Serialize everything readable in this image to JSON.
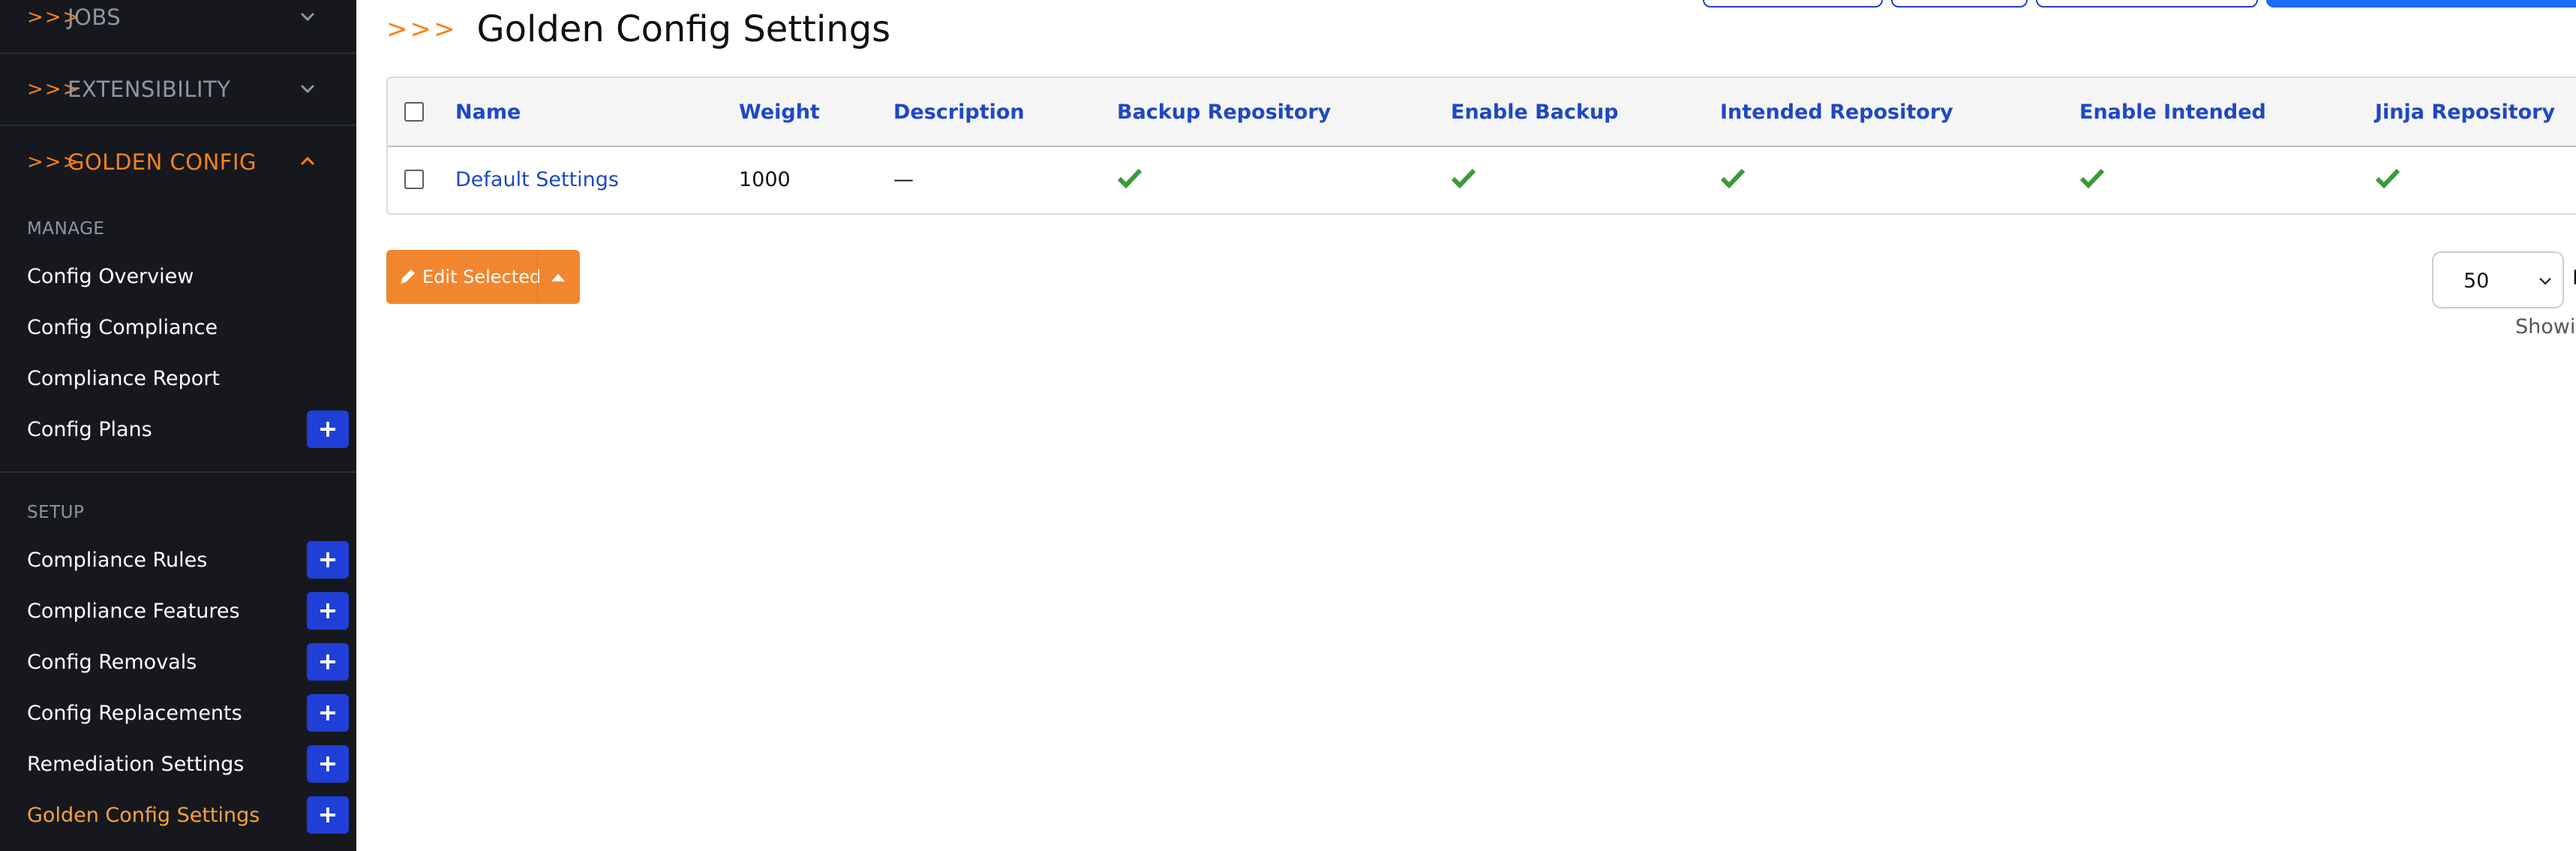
{
  "sidebar": {
    "groups": [
      {
        "label": "JOBS",
        "chevron": ">>>",
        "state": "collapsed"
      },
      {
        "label": "EXTENSIBILITY",
        "chevron": ">>>",
        "state": "collapsed"
      },
      {
        "label": "GOLDEN CONFIG",
        "chevron": ">>>",
        "state": "expanded"
      }
    ],
    "sections": [
      {
        "title": "MANAGE",
        "items": [
          {
            "label": "Config Overview",
            "add": false
          },
          {
            "label": "Config Compliance",
            "add": false
          },
          {
            "label": "Compliance Report",
            "add": false
          },
          {
            "label": "Config Plans",
            "add": true
          }
        ]
      },
      {
        "title": "SETUP",
        "items": [
          {
            "label": "Compliance Rules",
            "add": true
          },
          {
            "label": "Compliance Features",
            "add": true
          },
          {
            "label": "Config Removals",
            "add": true
          },
          {
            "label": "Config Replacements",
            "add": true
          },
          {
            "label": "Remediation Settings",
            "add": true
          },
          {
            "label": "Golden Config Settings",
            "add": true,
            "active": true
          }
        ]
      }
    ]
  },
  "page": {
    "title_chevron": ">>>",
    "title": "Golden Config Settings"
  },
  "table": {
    "columns": [
      "Name",
      "Weight",
      "Description",
      "Backup Repository",
      "Enable Backup",
      "Intended Repository",
      "Enable Intended",
      "Jinja Repository"
    ],
    "rows": [
      {
        "name": "Default Settings",
        "weight": "1000",
        "description": "—",
        "backup_repository": "check-icon",
        "enable_backup": "check-icon",
        "intended_repository": "check-icon",
        "enable_intended": "check-icon",
        "jinja_repository": "check-icon"
      }
    ]
  },
  "actions": {
    "edit_selected": "Edit Selected"
  },
  "pagination": {
    "per_page": "50",
    "after_select": "P",
    "showing": "Showing"
  },
  "colors": {
    "accent_orange": "#f7821e",
    "link_blue": "#1d48c7",
    "add_button_blue": "#1f3fd8",
    "check_green": "#3a9a3a",
    "sidebar_bg": "#16181e"
  }
}
